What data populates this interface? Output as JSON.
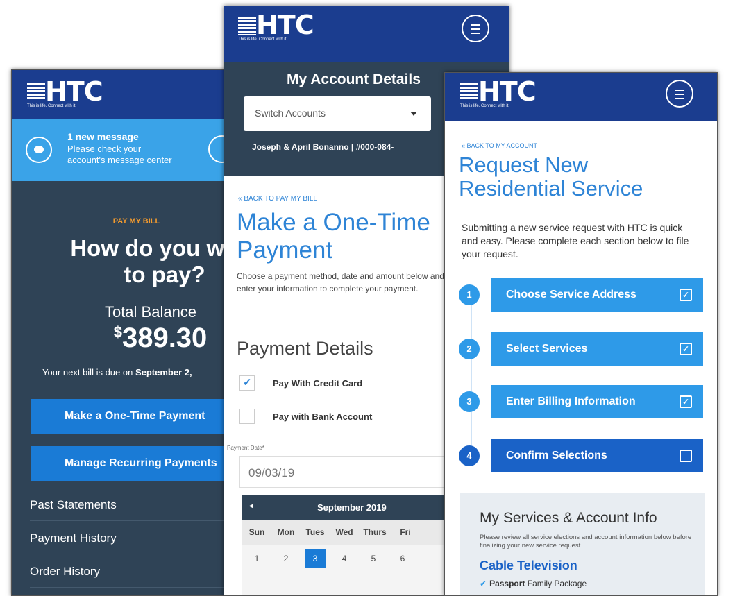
{
  "brand": {
    "logo_text": "HTC",
    "tagline": "This is life. Connect with it."
  },
  "screen_pay": {
    "message_title": "1 new message",
    "message_body": "Please check your account's message center",
    "eyebrow": "PAY MY BILL",
    "question": "How do you want to pay?",
    "balance_label": "Total Balance",
    "balance_currency": "$",
    "balance_amount": "389.30",
    "due_prefix": "Your next bill is due on ",
    "due_date": "September 2,",
    "one_time_button": "Make a One-Time Payment",
    "recurring_button": "Manage Recurring Payments",
    "links": [
      "Past Statements",
      "Payment History",
      "Order History"
    ]
  },
  "screen_onetime": {
    "header_title": "My Account Details",
    "switch_label": "Switch Accounts",
    "account_owner": "Joseph & April Bonanno | #000-084-",
    "back_link": "« BACK TO PAY MY BILL",
    "page_title": "Make a One-Time Payment",
    "intro": "Choose a payment method, date and amount below and then enter your information to complete your payment.",
    "section_title": "Payment Details",
    "option_card": "Pay With Credit Card",
    "option_bank": "Pay with Bank Account",
    "date_label": "Payment Date*",
    "date_value": "09/03/19",
    "calendar": {
      "prev_icon": "◂",
      "month": "September 2019",
      "weekdays": [
        "Sun",
        "Mon",
        "Tues",
        "Wed",
        "Thurs",
        "Fri"
      ],
      "week1": [
        "1",
        "2",
        "3",
        "4",
        "5",
        "6"
      ]
    }
  },
  "screen_request": {
    "back_link": "« BACK TO MY ACCOUNT",
    "title": "Request New Residential Service",
    "description": "Submitting a new service request with HTC is quick and easy. Please complete each section below to file your request.",
    "steps": [
      {
        "num": "1",
        "label": "Choose Service Address",
        "check": "✓"
      },
      {
        "num": "2",
        "label": "Select Services",
        "check": "✓"
      },
      {
        "num": "3",
        "label": "Enter Billing Information",
        "check": "✓"
      },
      {
        "num": "4",
        "label": "Confirm Selections",
        "check": ""
      }
    ],
    "info_title": "My Services & Account Info",
    "info_text": "Please review all service elections and account information below before finalizing your new service request.",
    "category": "Cable Television",
    "item_bold": "Passport",
    "item_rest": " Family Package"
  },
  "colors": {
    "header_navy": "#1b3d8f",
    "slate": "#2f4356",
    "accent_blue": "#2e9ae8",
    "button_blue": "#1a7bd6",
    "orange": "#f29a2e"
  }
}
